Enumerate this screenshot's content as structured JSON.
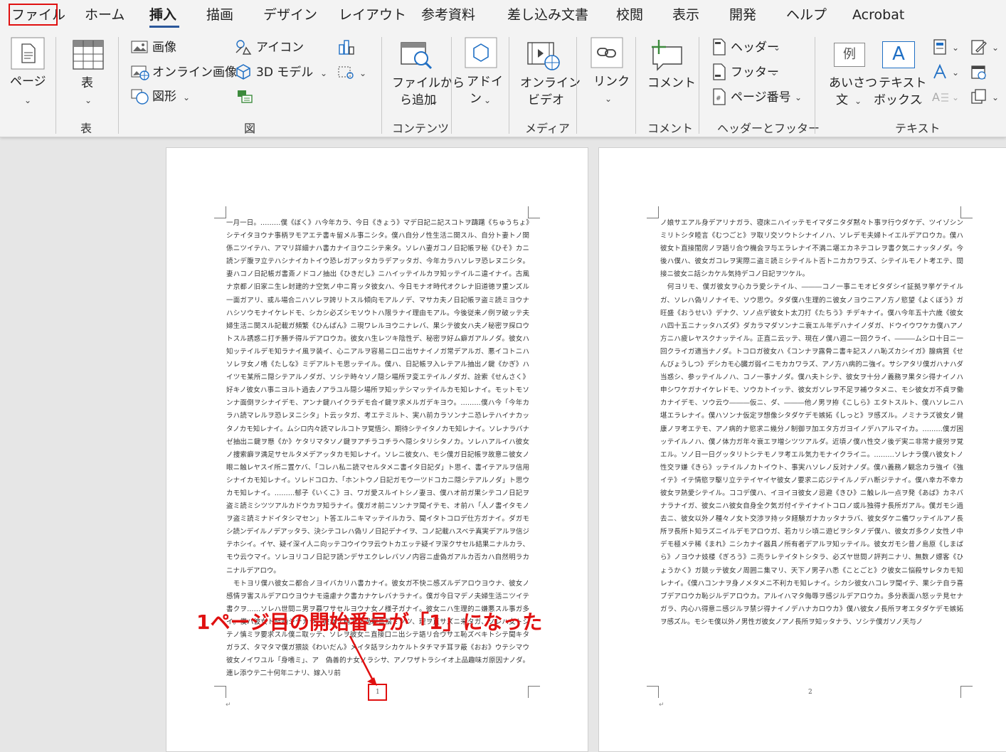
{
  "tabs": [
    "ファイル",
    "ホーム",
    "挿入",
    "描画",
    "デザイン",
    "レイアウト",
    "参考資料",
    "差し込み文書",
    "校閲",
    "表示",
    "開発",
    "ヘルプ",
    "Acrobat"
  ],
  "active_tab": "挿入",
  "ribbon": {
    "pages": {
      "label": "ページ"
    },
    "table": {
      "label": "表",
      "group": "表"
    },
    "illustrations": {
      "image": "画像",
      "online_image": "オンライン画像",
      "shapes": "図形",
      "icons": "アイコン",
      "model3d": "3D モデル",
      "group": "図"
    },
    "content": {
      "add_from_file": "ファイルから",
      "add_from_file2": "ら追加",
      "group": "コンテンツ"
    },
    "addins": {
      "label1": "アドイ",
      "label2": "ン"
    },
    "media": {
      "video1": "オンライン",
      "video2": "ビデオ",
      "group": "メディア"
    },
    "links": {
      "label": "リンク"
    },
    "comments": {
      "label": "コメント",
      "group": "コメント"
    },
    "header_footer": {
      "header": "ヘッダー",
      "footer": "フッター",
      "page_number": "ページ番号",
      "group": "ヘッダーとフッター"
    },
    "text": {
      "greeting1": "あいさつ",
      "greeting2": "文",
      "textbox1": "テキスト",
      "textbox2": "ボックス",
      "group": "テキスト",
      "example": "例",
      "a": "A"
    }
  },
  "document": {
    "page1_text": "一月一日。………僕《ぼく》ハ今年カラ、今日《きょう》マデ日記ニ記スコトヲ躊躇《ちゅうちょ》シテイタヨウナ事柄ヲモアエテ書キ留メル事ニシタ。僕ハ自分ノ性生活ニ関スル、自分ト妻トノ関係ニツイテハ、アマリ詳細ナハ書カナイヨウニシテ来タ。ソレハ妻ガコノ日記帳ヲ秘《ひそ》カニ読ンデ腹ヲ立テハシナイカトイウ恐レガアッタカラデアッタガ、今年カラハソレヲ恐レヌニシタ。妻ハコノ日記帳ガ書斎ノドコノ抽出《ひきだし》ニハイッテイルカヲ知ッテイルニ違イナイ。古風ナ京都ノ旧家ニ生レ封建的ナ空気ノ中ニ育ッタ彼女ハ、今日モナオ時代オクレナ旧道徳ヲ重ンズル一面ガアリ、或ル場合ニハソレヲ誇リトスル傾向モアルノデ、マサカ夫ノ日記帳ヲ盗ミ読ミヨウナハシソウモナイケレドモ、シカシ必ズシモソウトハ限ラナイ理由モアル。今後従来ノ例ヲ破ッテ夫婦生活ニ関スル記載ガ頻繁《ひんぱん》ニ現ワレルヨウニナレバ、果シテ彼女ハ夫ノ秘密ヲ探ロウトスル誘惑ニ打チ勝チ得ルデアロウカ。彼女ハ生レツキ陰性デ、秘密ヲ好ム癖ガアルノダ。彼女ハ知ッテイルデモ知ラナイ風ヲ装イ、心ニアルヲ容易ニ口ニ出サナイノガ常デアルガ、悪イコトニハソレヲ女ノ嗜《たしな》ミデアルトモ思ッテイル。僕ハ、日記帳ヲ入レテアル抽出ノ鍵《かぎ》ハイツモ某所ニ隠シテアルノダガ、ソシテ時々ソノ隠シ場所ヲ変エテイルノダガ、詮索《せんさく》好キノ彼女ハ事ニヨルト過去ノアラユル隠シ場所ヲ知ッテシマッテイルカモ知レナイ。モットモソンナ面倒ヲシナイデモ、アンナ鍵ハイクラデモ合イ鍵ヲ求メルガデキヨウ。………僕ハ今「今年カラハ読マレルヲ恐レヌニシタ」ト云ッタガ、考エテミルト、実ハ前カラソンナニ恐レテハイナカッタノカモ知レナイ。ムシロ内々読マレルコトヲ覚悟シ、期待シテイタノカモ知レナイ。ソレナラバナゼ抽出ニ鍵ヲ懸《か》ケタリマタソノ鍵ヲアチラコチラヘ隠シタリシタノカ。ソレハアルイハ彼女ノ捜索癖ヲ満足サセルタメデアッタカモ知レナイ。ソレニ彼女ハ、モシ僕ガ日記帳ヲ故意ニ彼女ノ眼ニ触レヤスイ所ニ置ケバ、「コレハ私ニ読マセルタメニ書イタ日記ダ」ト思イ、書イテアルヲ信用シナイカモ知レナイ。ソレドコロカ、「ホントウノ日記ガモウ一ツドコカニ隠シテアルノダ」ト思ウカモ知レナイ。………郁子《いくこ》ヨ、ワガ愛スルイトシノ妻ヨ、僕ハオ前ガ果シテコノ日記ヲ盗ミ読ミシツツアルカドウカヲ知ラナイ。僕ガオ前ニソンナヲ聞イテモ、オ前ハ「人ノ書イタモノヲ盗ミ読ミナドイタシマセン」ト答エルニキマッテイルカラ、聞イタトコロデ仕方ガナイ。ダガモシ読ンデイルノデアッタラ、決シテコレハ偽リノ日記デナイヲ、コノ記載ハスベテ真実デアルヲ信ジテホシイ。イヤ、疑イ深イ人ニ向ッテコウイウヲ云ウトカエッテ疑イヲ深クサセル結果ニナルカラ、モウ云ウマイ。ソレヨリコノ日記ヲ読ンデサエクレレバソノ内容ニ虚偽ガアルカ否カハ自然明ラカニナルデアロウ。\n　モトヨリ僕ハ彼女ニ都合ノヨイバカリハ書カナイ。彼女ガ不快ニ感ズルデアロウヨウナ、彼女ノ感情ヲ害スルデアロウヨウナモ遠慮ナク書カナケレバナラナイ。僕ガ今日マデノ夫婦生活ニツイテ書クヲ……ソレハ世間ニ男ヲ慕ワサセルヨウナ女ノ様子ガナイ。彼女ニハ生理的ニ嫌悪スル事ガ多イ。僕ハ彼女ト結婚シテカラ、彼女ノ精力ノ過剰ニ悩ミツツ、理ヲ直サズニ来タガ、ソレハ女トシテノ慎ミヲ要求スル僕ニ取ッテ、ソレヲ彼女ニ直接口ニ出シテ語リ合ウサエ恥ズベキトシテ聞キタガラズ、タマタマ僕ガ猥談《わいだん》メイタ話ヲシカケルトタチマチ耳ヲ蔽《おお》ウテシマウ彼女ノイワユル「身嗜ミ」、ア　偽善的ナ女ノラシサ、アノワザトラシイオ上品趣味ガ原因ナノダ。連レ添ウテ二十何年ニナリ、嫁入リ前",
    "page2_text": "ノ娘サエアル身デアリナガラ、寝床ニハイッテモイマダニタダ黙々ト事ヲ行ウダケデ、ツイゾシンミリトシタ睦言《むつごと》ヲ取リ交ソウトシナイノハ、ソレデモ夫婦トイエルデアロウカ。僕ハ彼女ト直接閨房ノヲ語リ合ウ機会ヲ与エラレナイ不満ニ堪エカネテコレヲ書ク気ニナッタノダ。今後ハ僕ハ、彼女ガコレヲ実際ニ盗ミ読ミシテイルト否トニカカワラズ、シテイルモノト考エテ、間接ニ彼女ニ話シカケル気持デコノ日記ヲツケル。\n　何ヨリモ、僕ガ彼女ヲ心カラ愛シテイル、―――コノ一事ニモオビタダシイ証拠ヲ挙ゲテイルガ、ソレハ偽リノナイモ、ソウ思ウ。タダ僕ハ生理的ニ彼女ノヨウニアノ方ノ慾望《よくぼう》ガ旺盛《おうせい》デナク、ソノ点デ彼女ト太刀打《たちう》チデキナイ。僕ハ今年五十六歳《彼女ハ四十五ニナッタハズダ》ダカラマダソンナニ衰エル年デハナイノダガ、ドウイウワケカ僕ハアノ方ニハ疲レヤスクナッテイル。正直ニ云ッテ、現在ノ僕ハ週ニ一回クライ、―――ムシロ十日ニ一回クライガ適当ナノダ。トコロガ彼女ハ《コンナヲ露骨ニ書キ記スノハ恥ズカシイガ》腺病質《せんびょうしつ》デシカモ心臓ガ弱イニモカカワラズ、アノ方ハ病的ニ強イ。サシアタリ僕ガハナハダ当惑シ、参ッテイルノハ、コノ一事ナノダ。僕ハ夫トシテ、彼女ヲ十分ノ義務ヲ果タシ得ナイノハ申シワケガナイケレドモ、ソウカトイッテ、彼女ガソレヲ不足ヲ補ウタメニ、モシ彼女ガ不貞ヲ働カナイデモ、ソウ云ウ―――仮ニ、ダ、―――他ノ男ヲ拵《こしら》エタトスルト、僕ハソレニハ堪エラレナイ。僕ハソンナ仮定ヲ想像シタダケデモ嫉妬《しっと》ヲ感ズル。ノミナラズ彼女ノ健康ノヲ考エテモ、アノ病的ナ慾求ニ幾分ノ制御ヲ加エタ方ガヨイノデハアルマイカ。………僕ガ困ッテイルノハ、僕ノ体力ガ年々衰エヲ増シツツアルダ。近頃ノ僕ハ性交ノ後デ実ニ非常ナ疲労ヲ覚エル。ソノ日一日グッタリトシテモノヲ考エル気力モナイクライニ。………ソレナラ僕ハ彼女トノ性交ヲ嫌《きら》ッテイルノカトイウト、事実ハソレノ反対ナノダ。僕ハ義務ノ観念カラ強イ《強イテ》イテ情慾ヲ駆リ立テテイヤイヤ彼女ノ要求ニ応ジテイルノデハ断ジテナイ。僕ハ幸カ不幸カ彼女ヲ熱愛シテイル。ココデ僕ハ、イヨイヨ彼女ノ忌避《きひ》ニ触レル一点ヲ発《あば》カネバナラナイガ、彼女ニハ彼女自身全ク気ガ付イテイナイトコロノ或ル独得ナ長所ガアル。僕ガモシ過去ニ、彼女以外ノ種々ノ女ト交渉ヲ持ッタ経験ガナカッタナラバ、彼女ダケニ備ワッテイルアノ長所ヲ長所ト知ラズニイルデモアロウガ、若カリシ頃ニ遊ビヲシタノデ僕ハ、彼女ガ多クノ女性ノ中デモ極メテ稀《まれ》ニシカナイ器具ノ所有者デアルヲ知ッテイル。彼女ガモシ昔ノ島原《しまばら》ノヨウナ妓楼《ぎろう》ニ売ラレテイタトシタラ、必ズヤ世間ノ評判ニナリ、無数ノ嫖客《ひょうかく》ガ競ッテ彼女ノ周囲ニ集マリ、天下ノ男子ハ悉《ことごと》ク彼女ニ悩殺サレタカモ知レナイ。《僕ハコンナヲ身ノメタメニ不利カモ知レナイ。シカシ彼女ハコレヲ聞イテ、果シテ自ラ喜ブデアロウカ恥ジルデアロウカ。アルイハマタ侮辱ヲ感ジルデアロウカ。多分表面ハ怒ッテ見セナガラ、内心ハ得意ニ感ジルヲ禁ジ得ナイノデハナカロウカ》僕ハ彼女ノ長所ヲ考エタダケデモ嫉妬ヲ感ズル。モシモ僕以外ノ男性ガ彼女ノアノ長所ヲ知ッタナラ、ソシテ僕ガソノ天与ノ",
    "page1_number": "1",
    "page2_number": "2",
    "para_mark": "↵"
  },
  "annotation": {
    "text": "1ページ目の開始番号が「1」になった"
  }
}
